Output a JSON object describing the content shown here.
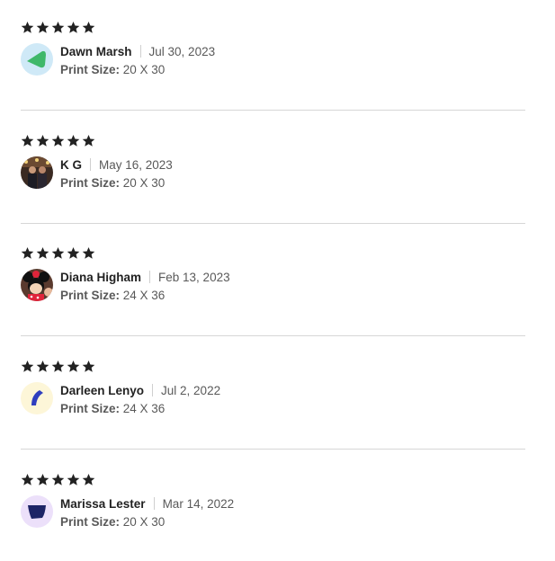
{
  "colors": {
    "star": "#222222",
    "divider": "#d6d6d6",
    "text_secondary": "#595959"
  },
  "reviews": [
    {
      "rating": 5,
      "name": "Dawn Marsh",
      "date": "Jul 30, 2023",
      "size_label": "Print Size:",
      "size_value": "20 X 30",
      "avatar": "default-avatar-green-shape"
    },
    {
      "rating": 5,
      "name": "K G",
      "date": "May 16, 2023",
      "size_label": "Print Size:",
      "size_value": "20 X 30",
      "avatar": "user-photo"
    },
    {
      "rating": 5,
      "name": "Diana Higham",
      "date": "Feb 13, 2023",
      "size_label": "Print Size:",
      "size_value": "24 X 36",
      "avatar": "user-photo-minnie-mouse"
    },
    {
      "rating": 5,
      "name": "Darleen Lenyo",
      "date": "Jul 2, 2022",
      "size_label": "Print Size:",
      "size_value": "24 X 36",
      "avatar": "default-avatar-blue-shape"
    },
    {
      "rating": 5,
      "name": "Marissa Lester",
      "date": "Mar 14, 2022",
      "size_label": "Print Size:",
      "size_value": "20 X 30",
      "avatar": "default-avatar-navy-shape"
    }
  ]
}
